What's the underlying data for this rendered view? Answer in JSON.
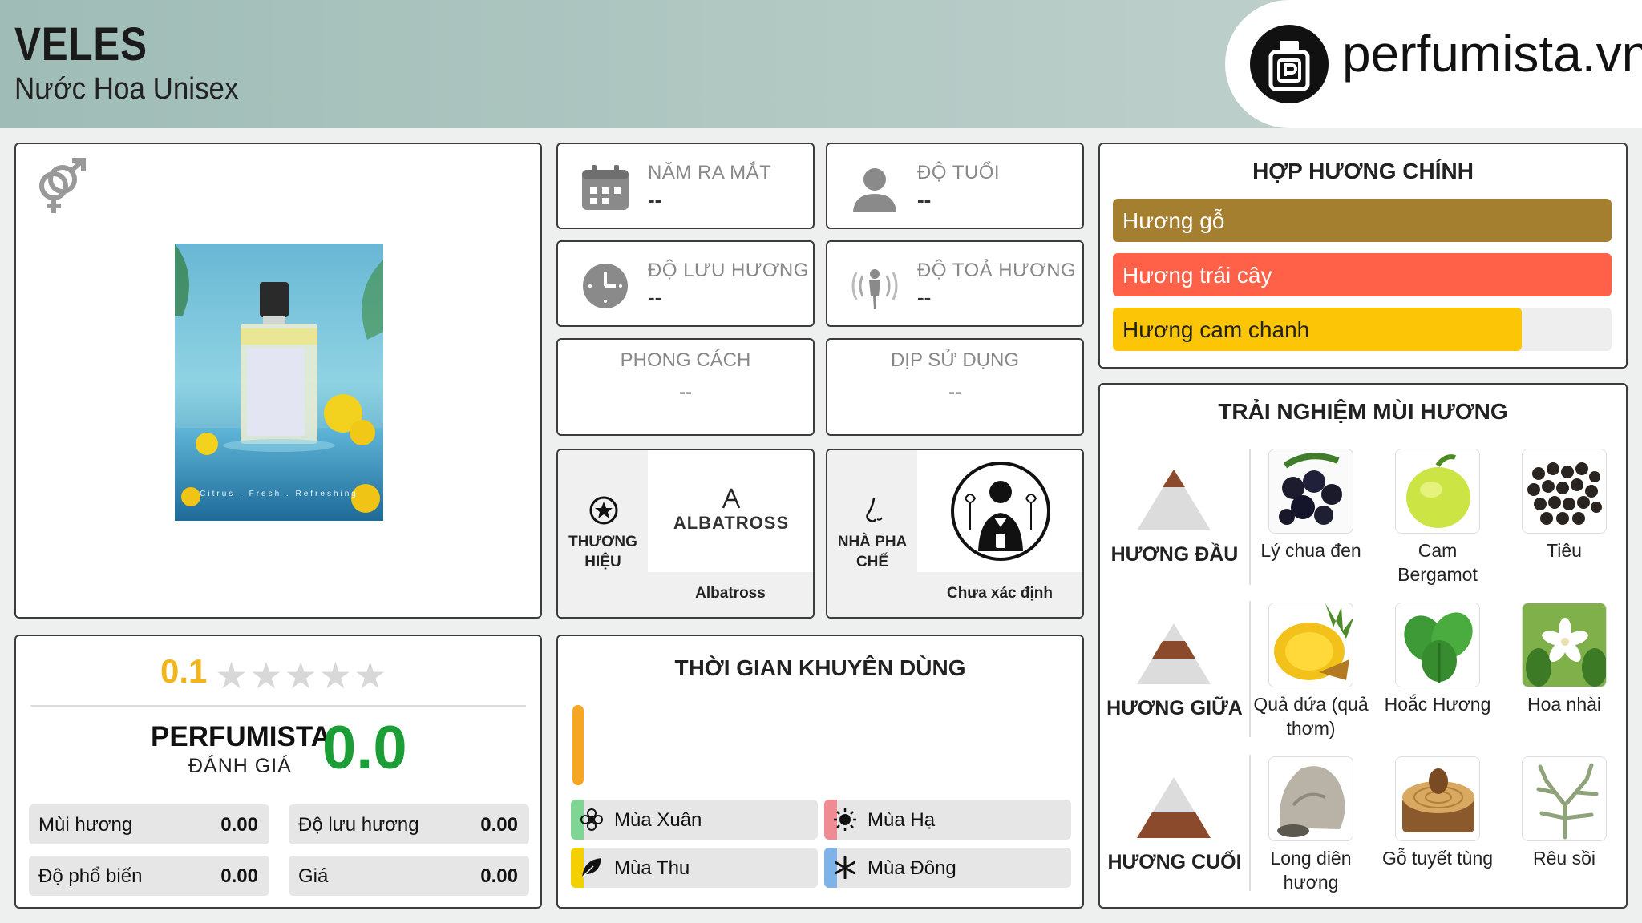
{
  "header": {
    "title": "VELES",
    "subtitle": "Nước Hoa Unisex",
    "brand_site": "perfumista.vn"
  },
  "product": {
    "gender_icon": "unisex-gender-icon",
    "image_caption": "Citrus . Fresh . Refreshing",
    "bottle_label": "ALBATROSS"
  },
  "info": {
    "release_year": {
      "label": "NĂM RA MẮT",
      "value": "--",
      "icon": "calendar-icon"
    },
    "age": {
      "label": "ĐỘ TUỔI",
      "value": "--",
      "icon": "person-icon"
    },
    "longevity": {
      "label": "ĐỘ LƯU HƯƠNG",
      "value": "--",
      "icon": "clock-icon"
    },
    "sillage": {
      "label": "ĐỘ TOẢ HƯƠNG",
      "value": "--",
      "icon": "sillage-icon"
    },
    "style": {
      "label": "PHONG CÁCH",
      "value": "--"
    },
    "occasion": {
      "label": "DỊP SỬ DỤNG",
      "value": "--"
    }
  },
  "brand": {
    "label_line1": "THƯƠNG",
    "label_line2": "HIỆU",
    "logo_text": "ALBATROSS",
    "name": "Albatross"
  },
  "perfumer": {
    "label_line1": "NHÀ PHA",
    "label_line2": "CHẾ",
    "name": "Chưa xác định"
  },
  "rating": {
    "user_score": "0.1",
    "stars_filled": 0,
    "stars_total": 5,
    "perfumista_title": "PERFUMISTA",
    "perfumista_sub": "ĐÁNH GIÁ",
    "perfumista_score": "0.0",
    "metrics": [
      {
        "label": "Mùi hương",
        "value": "0.00"
      },
      {
        "label": "Độ lưu hương",
        "value": "0.00"
      },
      {
        "label": "Độ phổ biến",
        "value": "0.00"
      },
      {
        "label": "Giá",
        "value": "0.00"
      }
    ]
  },
  "seasons": {
    "title": "THỜI GIAN KHUYÊN DÙNG",
    "items": [
      {
        "label": "Mùa Xuân",
        "icon": "flower-icon",
        "color": "#7fd694"
      },
      {
        "label": "Mùa Hạ",
        "icon": "sun-icon",
        "color": "#f08a93"
      },
      {
        "label": "Mùa Thu",
        "icon": "leaf-icon",
        "color": "#f4d000"
      },
      {
        "label": "Mùa Đông",
        "icon": "snowflake-icon",
        "color": "#7fb3e8"
      }
    ]
  },
  "accords": {
    "title": "HỢP HƯƠNG CHÍNH",
    "items": [
      {
        "label": "Hương gỗ",
        "color": "#a37f2f",
        "level": 1.0
      },
      {
        "label": "Hương trái cây",
        "color": "#fe6147",
        "level": 1.0
      },
      {
        "label": "Hương cam chanh",
        "color": "#fcc606",
        "level": 0.82
      }
    ]
  },
  "notes": {
    "title": "TRẢI NGHIỆM MÙI HƯƠNG",
    "tiers": [
      {
        "label": "HƯƠNG ĐẦU",
        "items": [
          "Lý chua đen",
          "Cam Bergamot",
          "Tiêu"
        ]
      },
      {
        "label": "HƯƠNG GIỮA",
        "items": [
          "Quả dứa (quả thơm)",
          "Hoắc Hương",
          "Hoa nhài"
        ]
      },
      {
        "label": "HƯƠNG CUỐI",
        "items": [
          "Long diên hương",
          "Gỗ tuyết tùng",
          "Rêu sồi"
        ]
      }
    ]
  }
}
